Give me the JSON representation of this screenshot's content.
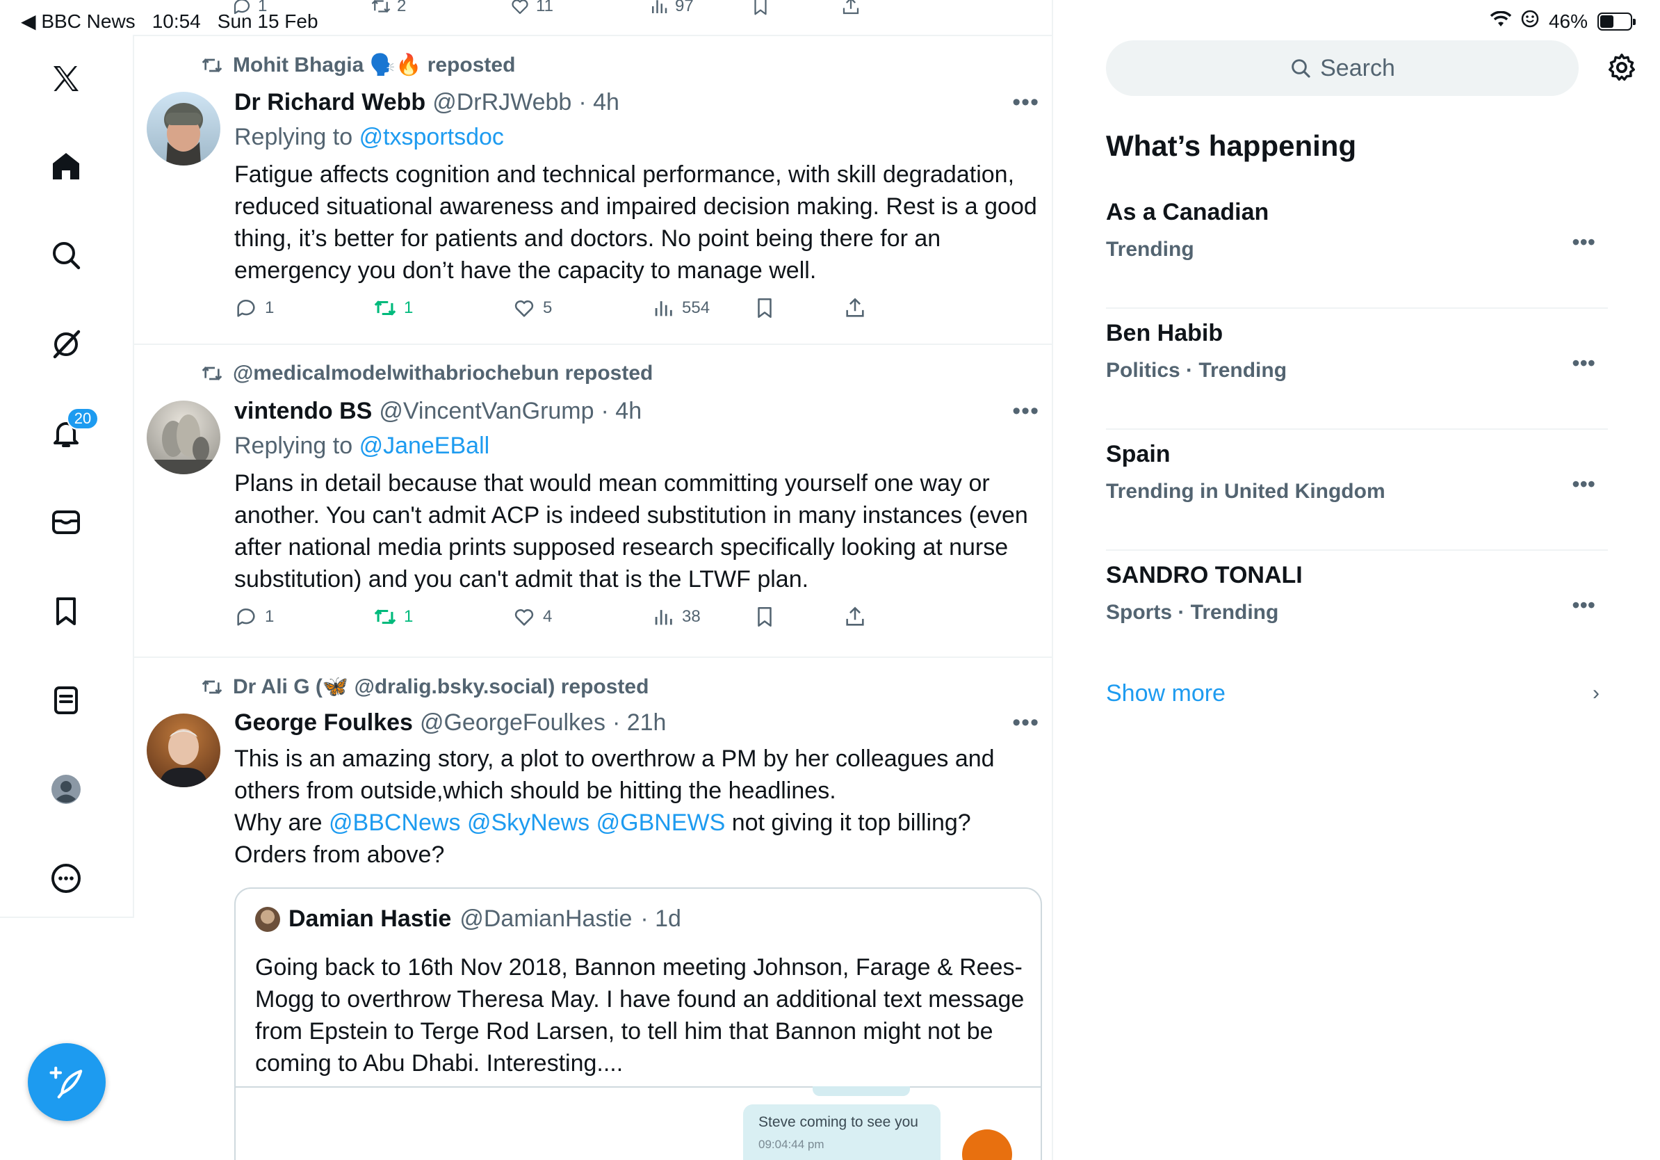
{
  "status_bar": {
    "back_app": "◀ BBC News",
    "time": "10:54",
    "date": "Sun 15 Feb",
    "battery": "46%",
    "battery_level": 0.46
  },
  "nav": {
    "notifications_badge": "20"
  },
  "prev_tweet_actions": {
    "replies": "1",
    "reposts": "2",
    "likes": "11",
    "views": "97"
  },
  "tweets": [
    {
      "repost_by": "Mohit Bhagia 🗣️🔥 reposted",
      "name": "Dr Richard Webb",
      "handle": "@DrRJWebb",
      "time": "· 4h",
      "reply_label": "Replying to",
      "reply_to": "@txsportsdoc",
      "body": "Fatigue affects cognition and technical performance, with skill degradation, reduced situational awareness and impaired decision making. Rest is a good thing, it’s better for patients and doctors. No point being there for an emergency you don’t have the capacity to manage well.",
      "replies": "1",
      "reposts": "1",
      "likes": "5",
      "views": "554"
    },
    {
      "repost_by": "@medicalmodelwithabriochebun reposted",
      "name": "vintendo BS",
      "handle": "@VincentVanGrump",
      "time": "· 4h",
      "reply_label": "Replying to",
      "reply_to": "@JaneEBall",
      "body": "Plans in detail because that would mean committing yourself one way or another. You can't admit ACP is indeed substitution in many instances (even after national media prints supposed research specifically looking at nurse substitution) and you can't admit that is the LTWF plan.",
      "replies": "1",
      "reposts": "1",
      "likes": "4",
      "views": "38"
    },
    {
      "repost_by": "Dr Ali G (🦋 @dralig.bsky.social) reposted",
      "name": "George Foulkes",
      "handle": "@GeorgeFoulkes",
      "time": "· 21h",
      "body_line1": "This is an amazing story, a plot to overthrow a PM by her colleagues and others from outside,which should be hitting the headlines.",
      "body_why": "Why are",
      "mention1": "@BBCNews",
      "mention2": "@SkyNews",
      "mention3": "@GBNEWS",
      "body_tail": "not giving it top billing?",
      "body_line3": "Orders from above?",
      "quote": {
        "name": "Damian Hastie",
        "handle": "@DamianHastie",
        "time": "· 1d",
        "body": "Going back to 16th Nov 2018, Bannon meeting Johnson, Farage & Rees-Mogg to overthrow Theresa May. I have found an additional text message from Epstein to Terge Rod Larsen, to tell him that Bannon might not be coming to Abu Dhabi. Interesting....",
        "media_message": "Steve coming to see you",
        "media_time": "09:04:44 pm"
      }
    }
  ],
  "sidebar": {
    "search_placeholder": "Search",
    "heading": "What’s happening",
    "trends": [
      {
        "title": "As a Canadian",
        "sub": "Trending"
      },
      {
        "title": "Ben Habib",
        "sub": "Politics · Trending"
      },
      {
        "title": "Spain",
        "sub": "Trending in United Kingdom"
      },
      {
        "title": "SANDRO TONALI",
        "sub": "Sports · Trending"
      }
    ],
    "show_more": "Show more"
  },
  "colors": {
    "accent": "#1d9bf0",
    "repost_green": "#00ba7c",
    "secondary_text": "#536471"
  }
}
